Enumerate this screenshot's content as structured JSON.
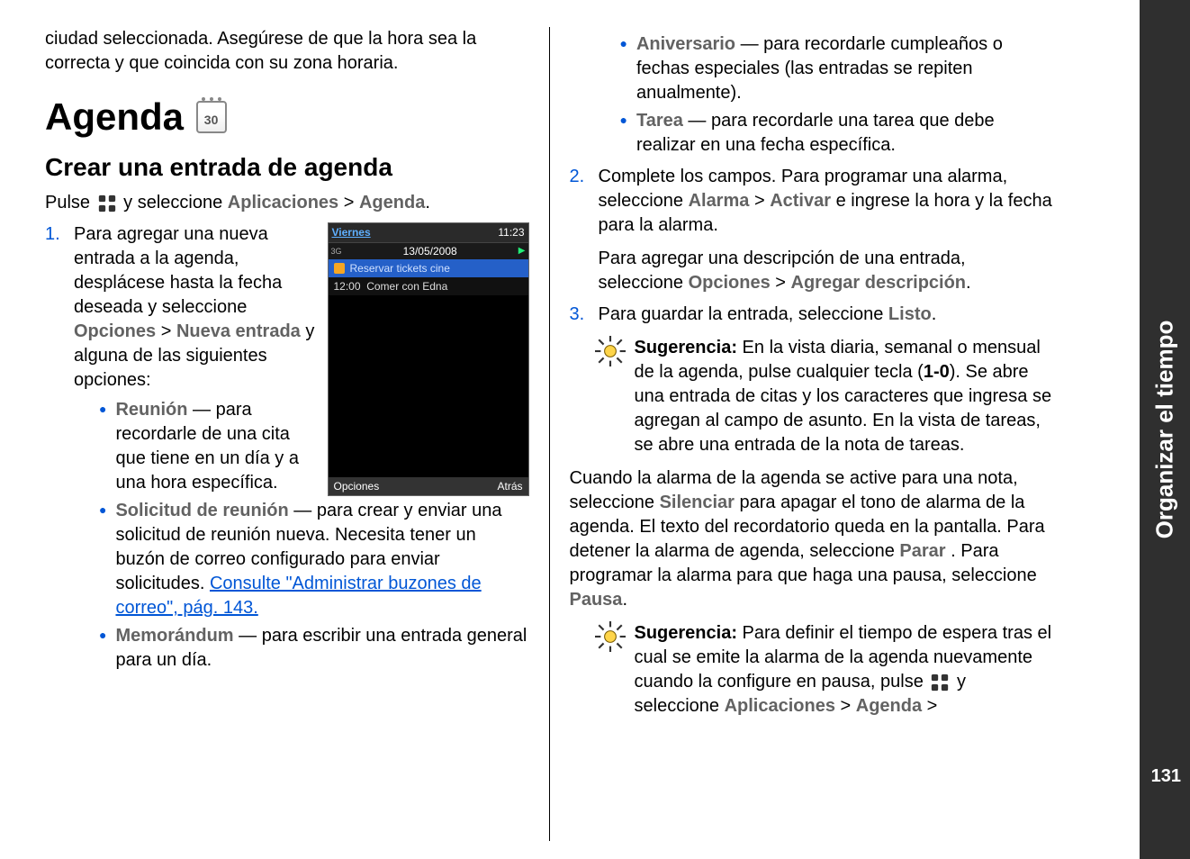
{
  "sideTab": {
    "label": "Organizar el tiempo",
    "pageNum": "131"
  },
  "left": {
    "intro": "ciudad seleccionada. Asegúrese de que la hora sea la correcta y que coincida con su zona horaria.",
    "h1": "Agenda",
    "calDay": "30",
    "h2": "Crear una entrada de agenda",
    "pulse_a": "Pulse ",
    "pulse_b": " y seleccione ",
    "apps": "Aplicaciones",
    "gt": " > ",
    "agenda": "Agenda",
    "dot": ".",
    "step1_a": "Para agregar una nueva entrada a la agenda, desplácese hasta la fecha deseada y seleccione ",
    "opciones": "Opciones",
    "nueva_entrada": "Nueva entrada",
    "step1_b": " y alguna de las siguientes opciones:",
    "b_reunion": "Reunión",
    "b_reunion_t": " — para recordarle de una cita que tiene en un día y a una hora específica.",
    "b_sol": "Solicitud de reunión",
    "b_sol_t": " — para crear y enviar una solicitud de reunión nueva. Necesita tener un buzón de correo configurado para enviar solicitudes. ",
    "b_sol_link": "Consulte \"Administrar buzones de correo\", pág. 143.",
    "b_memo": "Memorándum",
    "b_memo_t": " — para escribir una entrada general para un día.",
    "phone": {
      "day": "Viernes",
      "time": "11:23",
      "sig": "3G",
      "date": "13/05/2008",
      "row1": "Reservar tickets cine",
      "row2t": "12:00",
      "row2": "Comer con Edna",
      "opt": "Opciones",
      "back": "Atrás"
    }
  },
  "right": {
    "b_aniv": "Aniversario",
    "b_aniv_t": " — para recordarle cumpleaños o fechas especiales (las entradas se repiten anualmente).",
    "b_tarea": "Tarea",
    "b_tarea_t": " — para recordarle una tarea que debe realizar en una fecha específica.",
    "step2_a": "Complete los campos. Para programar una alarma, seleccione ",
    "alarma": "Alarma",
    "activar": "Activar",
    "step2_b": " e ingrese la hora y la fecha para la alarma.",
    "step2_c": "Para agregar una descripción de una entrada, seleccione ",
    "agregar_desc": "Agregar descripción",
    "step3_a": "Para guardar la entrada, seleccione ",
    "listo": "Listo",
    "tip1_label": "Sugerencia: ",
    "tip1_t": "En la vista diaria, semanal o mensual de la agenda, pulse cualquier tecla (",
    "tip1_keys": "1-0",
    "tip1_t2": "). Se abre una entrada de citas y los caracteres que ingresa se agregan al campo de asunto. En la vista de tareas, se abre una entrada de la nota de tareas.",
    "para_a": "Cuando la alarma de la agenda se active para una nota, seleccione ",
    "silenciar": "Silenciar",
    "para_b": " para apagar el tono de alarma de la agenda. El texto del recordatorio queda en la pantalla. Para detener la alarma de agenda, seleccione ",
    "parar": "Parar",
    "para_c": ". Para programar la alarma para que haga una pausa, seleccione ",
    "pausa": "Pausa",
    "tip2_label": "Sugerencia: ",
    "tip2_t": "Para definir el tiempo de espera tras el cual se emite la alarma de la agenda nuevamente cuando la configure en pausa, pulse ",
    "tip2_b": " y seleccione ",
    "apps2": "Aplicaciones",
    "agenda2": "Agenda"
  }
}
